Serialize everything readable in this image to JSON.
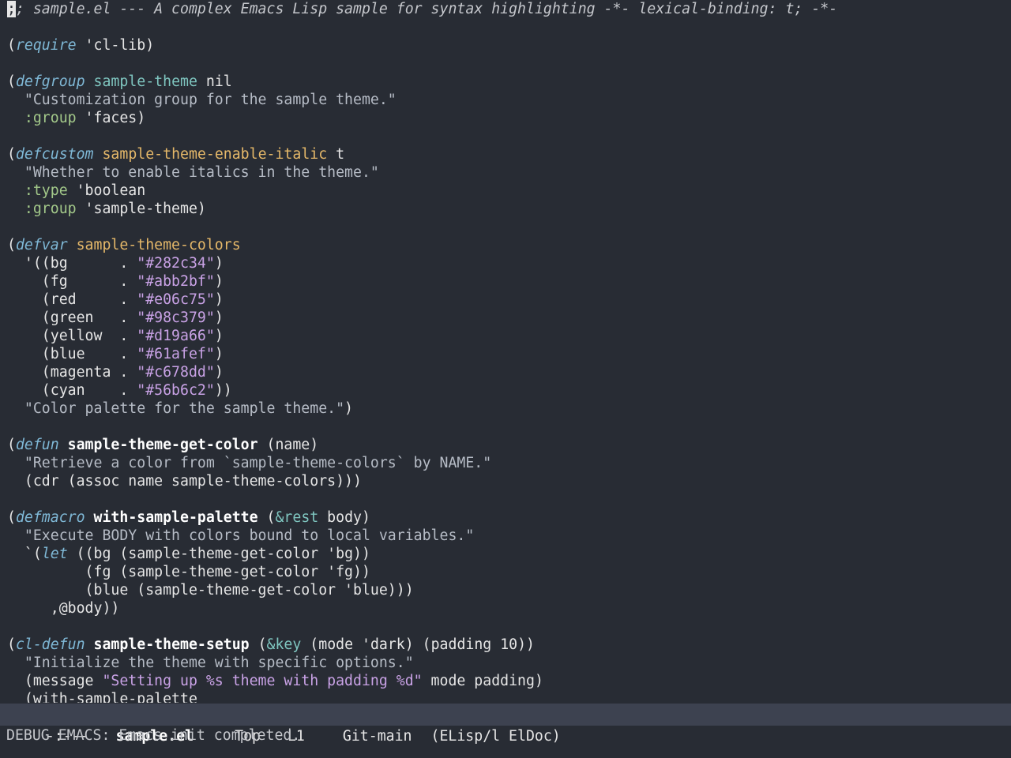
{
  "theme_colors": {
    "background": "#282c34",
    "modeline_bg": "#3d4250",
    "comment": "#c5c7cc",
    "keyword": "#7fb8d6",
    "variable_name": "#e5b869",
    "function_name": "#ffffff",
    "string": "#b6bcc6",
    "constant": "#c9a2e6",
    "keyword_arg": "#a3c98a"
  },
  "buffer": {
    "lines": [
      [
        {
          "t": ";",
          "c": "cursor"
        },
        {
          "t": "; sample.el --- A complex Emacs Lisp sample for syntax highlighting -*- lexical-binding: t; -*-",
          "c": "comment"
        }
      ],
      [],
      [
        {
          "t": "(",
          "c": "plain"
        },
        {
          "t": "require",
          "c": "kw"
        },
        {
          "t": " 'cl-lib)",
          "c": "plain"
        }
      ],
      [],
      [
        {
          "t": "(",
          "c": "plain"
        },
        {
          "t": "defgroup",
          "c": "kw"
        },
        {
          "t": " ",
          "c": "plain"
        },
        {
          "t": "sample-theme",
          "c": "def"
        },
        {
          "t": " nil",
          "c": "plain"
        }
      ],
      [
        {
          "t": "  \"Customization group for the sample theme.\"",
          "c": "str"
        }
      ],
      [
        {
          "t": "  ",
          "c": "plain"
        },
        {
          "t": ":group",
          "c": "key"
        },
        {
          "t": " 'faces)",
          "c": "plain"
        }
      ],
      [],
      [
        {
          "t": "(",
          "c": "plain"
        },
        {
          "t": "defcustom",
          "c": "kw"
        },
        {
          "t": " ",
          "c": "plain"
        },
        {
          "t": "sample-theme-enable-italic",
          "c": "var"
        },
        {
          "t": " t",
          "c": "plain"
        }
      ],
      [
        {
          "t": "  \"Whether to enable italics in the theme.\"",
          "c": "str"
        }
      ],
      [
        {
          "t": "  ",
          "c": "plain"
        },
        {
          "t": ":type",
          "c": "key"
        },
        {
          "t": " 'boolean",
          "c": "plain"
        }
      ],
      [
        {
          "t": "  ",
          "c": "plain"
        },
        {
          "t": ":group",
          "c": "key"
        },
        {
          "t": " 'sample-theme)",
          "c": "plain"
        }
      ],
      [],
      [
        {
          "t": "(",
          "c": "plain"
        },
        {
          "t": "defvar",
          "c": "kw"
        },
        {
          "t": " ",
          "c": "plain"
        },
        {
          "t": "sample-theme-colors",
          "c": "var"
        }
      ],
      [
        {
          "t": "  '((bg      . ",
          "c": "plain"
        },
        {
          "t": "\"#282c34\"",
          "c": "const"
        },
        {
          "t": ")",
          "c": "plain"
        }
      ],
      [
        {
          "t": "    (fg      . ",
          "c": "plain"
        },
        {
          "t": "\"#abb2bf\"",
          "c": "const"
        },
        {
          "t": ")",
          "c": "plain"
        }
      ],
      [
        {
          "t": "    (red     . ",
          "c": "plain"
        },
        {
          "t": "\"#e06c75\"",
          "c": "const"
        },
        {
          "t": ")",
          "c": "plain"
        }
      ],
      [
        {
          "t": "    (green   . ",
          "c": "plain"
        },
        {
          "t": "\"#98c379\"",
          "c": "const"
        },
        {
          "t": ")",
          "c": "plain"
        }
      ],
      [
        {
          "t": "    (yellow  . ",
          "c": "plain"
        },
        {
          "t": "\"#d19a66\"",
          "c": "const"
        },
        {
          "t": ")",
          "c": "plain"
        }
      ],
      [
        {
          "t": "    (blue    . ",
          "c": "plain"
        },
        {
          "t": "\"#61afef\"",
          "c": "const"
        },
        {
          "t": ")",
          "c": "plain"
        }
      ],
      [
        {
          "t": "    (magenta . ",
          "c": "plain"
        },
        {
          "t": "\"#c678dd\"",
          "c": "const"
        },
        {
          "t": ")",
          "c": "plain"
        }
      ],
      [
        {
          "t": "    (cyan    . ",
          "c": "plain"
        },
        {
          "t": "\"#56b6c2\"",
          "c": "const"
        },
        {
          "t": "))",
          "c": "plain"
        }
      ],
      [
        {
          "t": "  \"Color palette for the sample theme.\"",
          "c": "str"
        },
        {
          "t": ")",
          "c": "plain"
        }
      ],
      [],
      [
        {
          "t": "(",
          "c": "plain"
        },
        {
          "t": "defun",
          "c": "kw"
        },
        {
          "t": " ",
          "c": "plain"
        },
        {
          "t": "sample-theme-get-color",
          "c": "fn"
        },
        {
          "t": " (name)",
          "c": "plain"
        }
      ],
      [
        {
          "t": "  \"Retrieve a color from `sample-theme-colors` by NAME.\"",
          "c": "str"
        }
      ],
      [
        {
          "t": "  (cdr (assoc name sample-theme-colors)))",
          "c": "plain"
        }
      ],
      [],
      [
        {
          "t": "(",
          "c": "plain"
        },
        {
          "t": "defmacro",
          "c": "kw"
        },
        {
          "t": " ",
          "c": "plain"
        },
        {
          "t": "with-sample-palette",
          "c": "fn"
        },
        {
          "t": " (",
          "c": "plain"
        },
        {
          "t": "&rest",
          "c": "param"
        },
        {
          "t": " body)",
          "c": "plain"
        }
      ],
      [
        {
          "t": "  \"Execute BODY with colors bound to local variables.\"",
          "c": "str"
        }
      ],
      [
        {
          "t": "  `(",
          "c": "plain"
        },
        {
          "t": "let",
          "c": "kw"
        },
        {
          "t": " ((bg (sample-theme-get-color 'bg))",
          "c": "plain"
        }
      ],
      [
        {
          "t": "         (fg (sample-theme-get-color 'fg))",
          "c": "plain"
        }
      ],
      [
        {
          "t": "         (blue (sample-theme-get-color 'blue)))",
          "c": "plain"
        }
      ],
      [
        {
          "t": "     ,@body))",
          "c": "plain"
        }
      ],
      [],
      [
        {
          "t": "(",
          "c": "plain"
        },
        {
          "t": "cl-defun",
          "c": "kw"
        },
        {
          "t": " ",
          "c": "plain"
        },
        {
          "t": "sample-theme-setup",
          "c": "fn"
        },
        {
          "t": " (",
          "c": "plain"
        },
        {
          "t": "&key",
          "c": "param"
        },
        {
          "t": " (mode 'dark) (padding 10))",
          "c": "plain"
        }
      ],
      [
        {
          "t": "  \"Initialize the theme with specific options.\"",
          "c": "str"
        }
      ],
      [
        {
          "t": "  (message ",
          "c": "plain"
        },
        {
          "t": "\"Setting up %s theme with padding %d\"",
          "c": "const"
        },
        {
          "t": " mode padding)",
          "c": "plain"
        }
      ],
      [
        {
          "t": "  (with-sample-palette",
          "c": "plain"
        }
      ]
    ]
  },
  "modeline": {
    "state": "-:---",
    "buffer_name": "sample.el",
    "position": "Top",
    "line": "L1",
    "vc": "Git-main",
    "modes": "(ELisp/l ElDoc)"
  },
  "echo_area": {
    "message": "DEBUG EMACS: Emacs init completed."
  }
}
